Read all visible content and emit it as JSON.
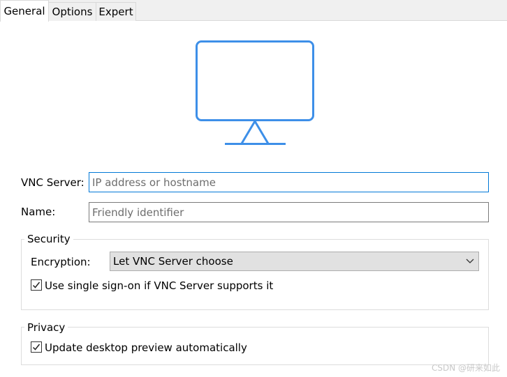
{
  "tabs": [
    {
      "label": "General",
      "active": true
    },
    {
      "label": "Options",
      "active": false
    },
    {
      "label": "Expert",
      "active": false
    }
  ],
  "monitor_icon": "monitor-icon",
  "accent_color": "#3d8fe8",
  "server": {
    "label": "VNC Server:",
    "value": "",
    "placeholder": "IP address or hostname"
  },
  "name": {
    "label": "Name:",
    "value": "",
    "placeholder": "Friendly identifier"
  },
  "security": {
    "title": "Security",
    "encryption_label": "Encryption:",
    "encryption_value": "Let VNC Server choose",
    "sso_label": "Use single sign-on if VNC Server supports it",
    "sso_checked": true
  },
  "privacy": {
    "title": "Privacy",
    "preview_label": "Update desktop preview automatically",
    "preview_checked": true
  },
  "watermark": "CSDN @研来如此"
}
